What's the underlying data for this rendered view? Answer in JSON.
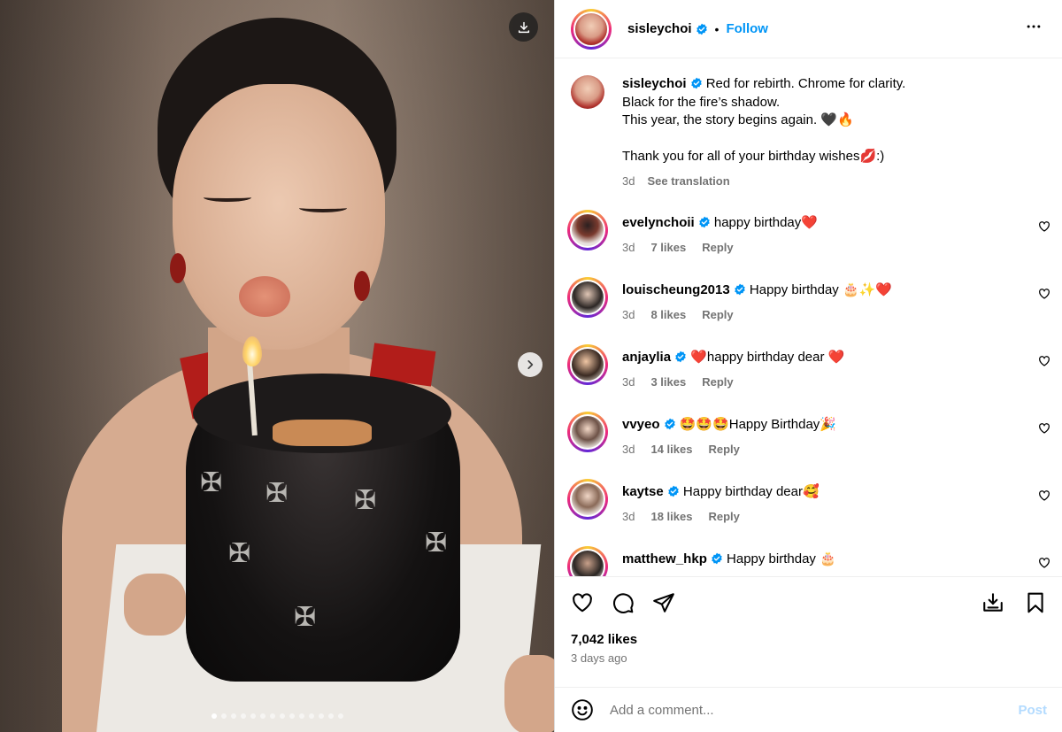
{
  "post": {
    "username": "sisleychoi",
    "follow_label": "Follow",
    "bullet": "•",
    "caption_lines": [
      "Red for rebirth. Chrome for clarity.",
      "Black for the fire’s shadow.",
      "This year, the story begins again. 🖤🔥",
      "",
      "Thank you for all of your birthday wishes💋:)"
    ],
    "caption_age": "3d",
    "see_translation": "See translation",
    "likes": "7,042 likes",
    "posted_ago": "3 days ago"
  },
  "media": {
    "slide_count": 14,
    "active_slide": 1
  },
  "comments": [
    {
      "username": "evelynchoii",
      "text": "happy birthday❤️",
      "age": "3d",
      "likes": "7 likes",
      "reply": "Reply"
    },
    {
      "username": "louischeung2013",
      "text": "Happy birthday 🎂✨❤️",
      "age": "3d",
      "likes": "8 likes",
      "reply": "Reply"
    },
    {
      "username": "anjaylia",
      "text": "❤️happy birthday dear ❤️",
      "age": "3d",
      "likes": "3 likes",
      "reply": "Reply"
    },
    {
      "username": "vvyeo",
      "text": "🤩🤩🤩Happy Birthday🎉",
      "age": "3d",
      "likes": "14 likes",
      "reply": "Reply"
    },
    {
      "username": "kaytse",
      "text": "Happy birthday dear🥰",
      "age": "3d",
      "likes": "18 likes",
      "reply": "Reply"
    },
    {
      "username": "matthew_hkp",
      "text": "Happy birthday 🎂",
      "age": "",
      "likes": "",
      "reply": ""
    }
  ],
  "composer": {
    "placeholder": "Add a comment...",
    "post_label": "Post"
  },
  "colors": {
    "link_blue": "#0095f6",
    "muted": "#737373",
    "verified": "#0095f6",
    "post_disabled": "#b3dbff"
  },
  "icons": [
    "download-icon",
    "chevron-right-icon",
    "verified-badge-icon",
    "more-options-icon",
    "heart-icon",
    "comment-icon",
    "share-icon",
    "save-to-collection-icon",
    "bookmark-icon",
    "emoji-icon"
  ]
}
